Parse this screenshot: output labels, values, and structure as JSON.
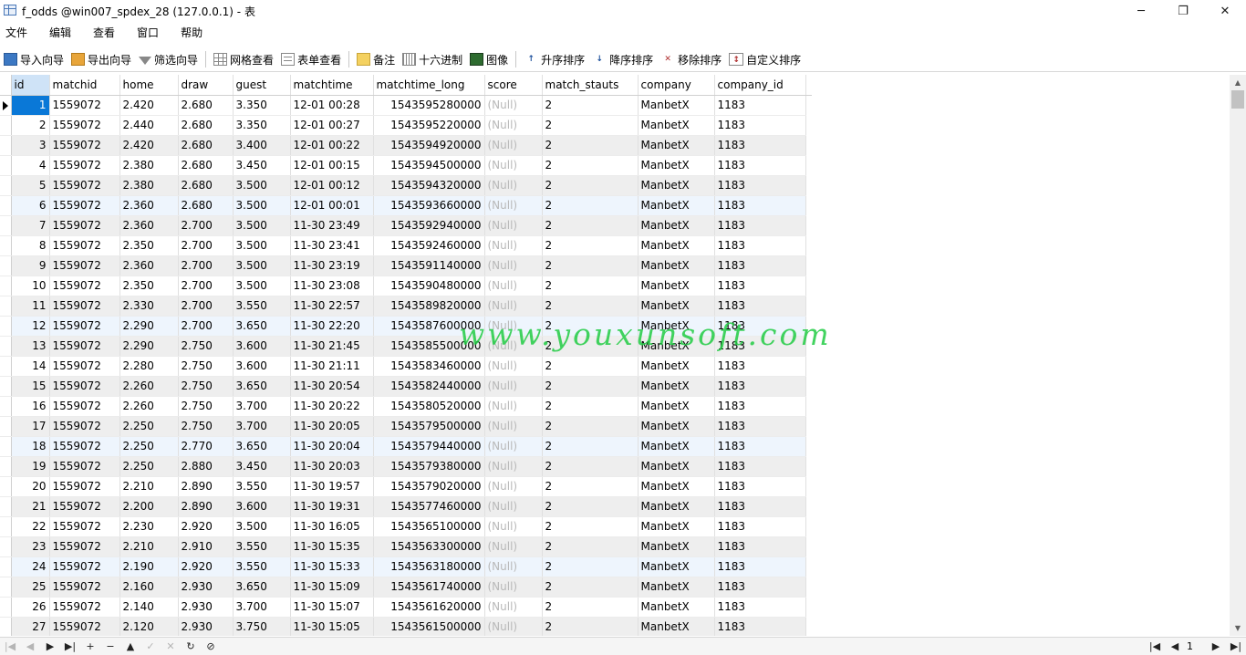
{
  "window": {
    "title": "f_odds @win007_spdex_28 (127.0.0.1) - 表",
    "minimize": "─",
    "maximize": "❐",
    "close": "✕"
  },
  "menu": [
    "文件",
    "编辑",
    "查看",
    "窗口",
    "帮助"
  ],
  "toolbar": {
    "import_wizard": "导入向导",
    "export_wizard": "导出向导",
    "filter_wizard": "筛选向导",
    "grid_view": "网格查看",
    "form_view": "表单查看",
    "memo": "备注",
    "hex": "十六进制",
    "image": "图像",
    "sort_asc": "升序排序",
    "sort_desc": "降序排序",
    "remove_sort": "移除排序",
    "custom_sort": "自定义排序"
  },
  "columns": [
    "id",
    "matchid",
    "home",
    "draw",
    "guest",
    "matchtime",
    "matchtime_long",
    "score",
    "match_stauts",
    "company",
    "company_id"
  ],
  "rows": [
    [
      "1",
      "1559072",
      "2.420",
      "2.680",
      "3.350",
      "12-01 00:28",
      "1543595280000",
      "(Null)",
      "2",
      "ManbetX",
      "1183"
    ],
    [
      "2",
      "1559072",
      "2.440",
      "2.680",
      "3.350",
      "12-01 00:27",
      "1543595220000",
      "(Null)",
      "2",
      "ManbetX",
      "1183"
    ],
    [
      "3",
      "1559072",
      "2.420",
      "2.680",
      "3.400",
      "12-01 00:22",
      "1543594920000",
      "(Null)",
      "2",
      "ManbetX",
      "1183"
    ],
    [
      "4",
      "1559072",
      "2.380",
      "2.680",
      "3.450",
      "12-01 00:15",
      "1543594500000",
      "(Null)",
      "2",
      "ManbetX",
      "1183"
    ],
    [
      "5",
      "1559072",
      "2.380",
      "2.680",
      "3.500",
      "12-01 00:12",
      "1543594320000",
      "(Null)",
      "2",
      "ManbetX",
      "1183"
    ],
    [
      "6",
      "1559072",
      "2.360",
      "2.680",
      "3.500",
      "12-01 00:01",
      "1543593660000",
      "(Null)",
      "2",
      "ManbetX",
      "1183"
    ],
    [
      "7",
      "1559072",
      "2.360",
      "2.700",
      "3.500",
      "11-30 23:49",
      "1543592940000",
      "(Null)",
      "2",
      "ManbetX",
      "1183"
    ],
    [
      "8",
      "1559072",
      "2.350",
      "2.700",
      "3.500",
      "11-30 23:41",
      "1543592460000",
      "(Null)",
      "2",
      "ManbetX",
      "1183"
    ],
    [
      "9",
      "1559072",
      "2.360",
      "2.700",
      "3.500",
      "11-30 23:19",
      "1543591140000",
      "(Null)",
      "2",
      "ManbetX",
      "1183"
    ],
    [
      "10",
      "1559072",
      "2.350",
      "2.700",
      "3.500",
      "11-30 23:08",
      "1543590480000",
      "(Null)",
      "2",
      "ManbetX",
      "1183"
    ],
    [
      "11",
      "1559072",
      "2.330",
      "2.700",
      "3.550",
      "11-30 22:57",
      "1543589820000",
      "(Null)",
      "2",
      "ManbetX",
      "1183"
    ],
    [
      "12",
      "1559072",
      "2.290",
      "2.700",
      "3.650",
      "11-30 22:20",
      "1543587600000",
      "(Null)",
      "2",
      "ManbetX",
      "1183"
    ],
    [
      "13",
      "1559072",
      "2.290",
      "2.750",
      "3.600",
      "11-30 21:45",
      "1543585500000",
      "(Null)",
      "2",
      "ManbetX",
      "1183"
    ],
    [
      "14",
      "1559072",
      "2.280",
      "2.750",
      "3.600",
      "11-30 21:11",
      "1543583460000",
      "(Null)",
      "2",
      "ManbetX",
      "1183"
    ],
    [
      "15",
      "1559072",
      "2.260",
      "2.750",
      "3.650",
      "11-30 20:54",
      "1543582440000",
      "(Null)",
      "2",
      "ManbetX",
      "1183"
    ],
    [
      "16",
      "1559072",
      "2.260",
      "2.750",
      "3.700",
      "11-30 20:22",
      "1543580520000",
      "(Null)",
      "2",
      "ManbetX",
      "1183"
    ],
    [
      "17",
      "1559072",
      "2.250",
      "2.750",
      "3.700",
      "11-30 20:05",
      "1543579500000",
      "(Null)",
      "2",
      "ManbetX",
      "1183"
    ],
    [
      "18",
      "1559072",
      "2.250",
      "2.770",
      "3.650",
      "11-30 20:04",
      "1543579440000",
      "(Null)",
      "2",
      "ManbetX",
      "1183"
    ],
    [
      "19",
      "1559072",
      "2.250",
      "2.880",
      "3.450",
      "11-30 20:03",
      "1543579380000",
      "(Null)",
      "2",
      "ManbetX",
      "1183"
    ],
    [
      "20",
      "1559072",
      "2.210",
      "2.890",
      "3.550",
      "11-30 19:57",
      "1543579020000",
      "(Null)",
      "2",
      "ManbetX",
      "1183"
    ],
    [
      "21",
      "1559072",
      "2.200",
      "2.890",
      "3.600",
      "11-30 19:31",
      "1543577460000",
      "(Null)",
      "2",
      "ManbetX",
      "1183"
    ],
    [
      "22",
      "1559072",
      "2.230",
      "2.920",
      "3.500",
      "11-30 16:05",
      "1543565100000",
      "(Null)",
      "2",
      "ManbetX",
      "1183"
    ],
    [
      "23",
      "1559072",
      "2.210",
      "2.910",
      "3.550",
      "11-30 15:35",
      "1543563300000",
      "(Null)",
      "2",
      "ManbetX",
      "1183"
    ],
    [
      "24",
      "1559072",
      "2.190",
      "2.920",
      "3.550",
      "11-30 15:33",
      "1543563180000",
      "(Null)",
      "2",
      "ManbetX",
      "1183"
    ],
    [
      "25",
      "1559072",
      "2.160",
      "2.930",
      "3.650",
      "11-30 15:09",
      "1543561740000",
      "(Null)",
      "2",
      "ManbetX",
      "1183"
    ],
    [
      "26",
      "1559072",
      "2.140",
      "2.930",
      "3.700",
      "11-30 15:07",
      "1543561620000",
      "(Null)",
      "2",
      "ManbetX",
      "1183"
    ],
    [
      "27",
      "1559072",
      "2.120",
      "2.930",
      "3.750",
      "11-30 15:05",
      "1543561500000",
      "(Null)",
      "2",
      "ManbetX",
      "1183"
    ]
  ],
  "watermark": "www.youxunsoft.com",
  "nav": {
    "first": "|◀",
    "prev": "◀",
    "next": "▶",
    "last": "▶|",
    "add": "+",
    "delete": "−",
    "up": "▲",
    "check": "✓",
    "cancel": "✕",
    "refresh": "↻",
    "stop": "⊘",
    "page_first": "|◀",
    "page_prev": "◀",
    "page": "1",
    "page_next": "▶",
    "page_last": "▶|"
  }
}
